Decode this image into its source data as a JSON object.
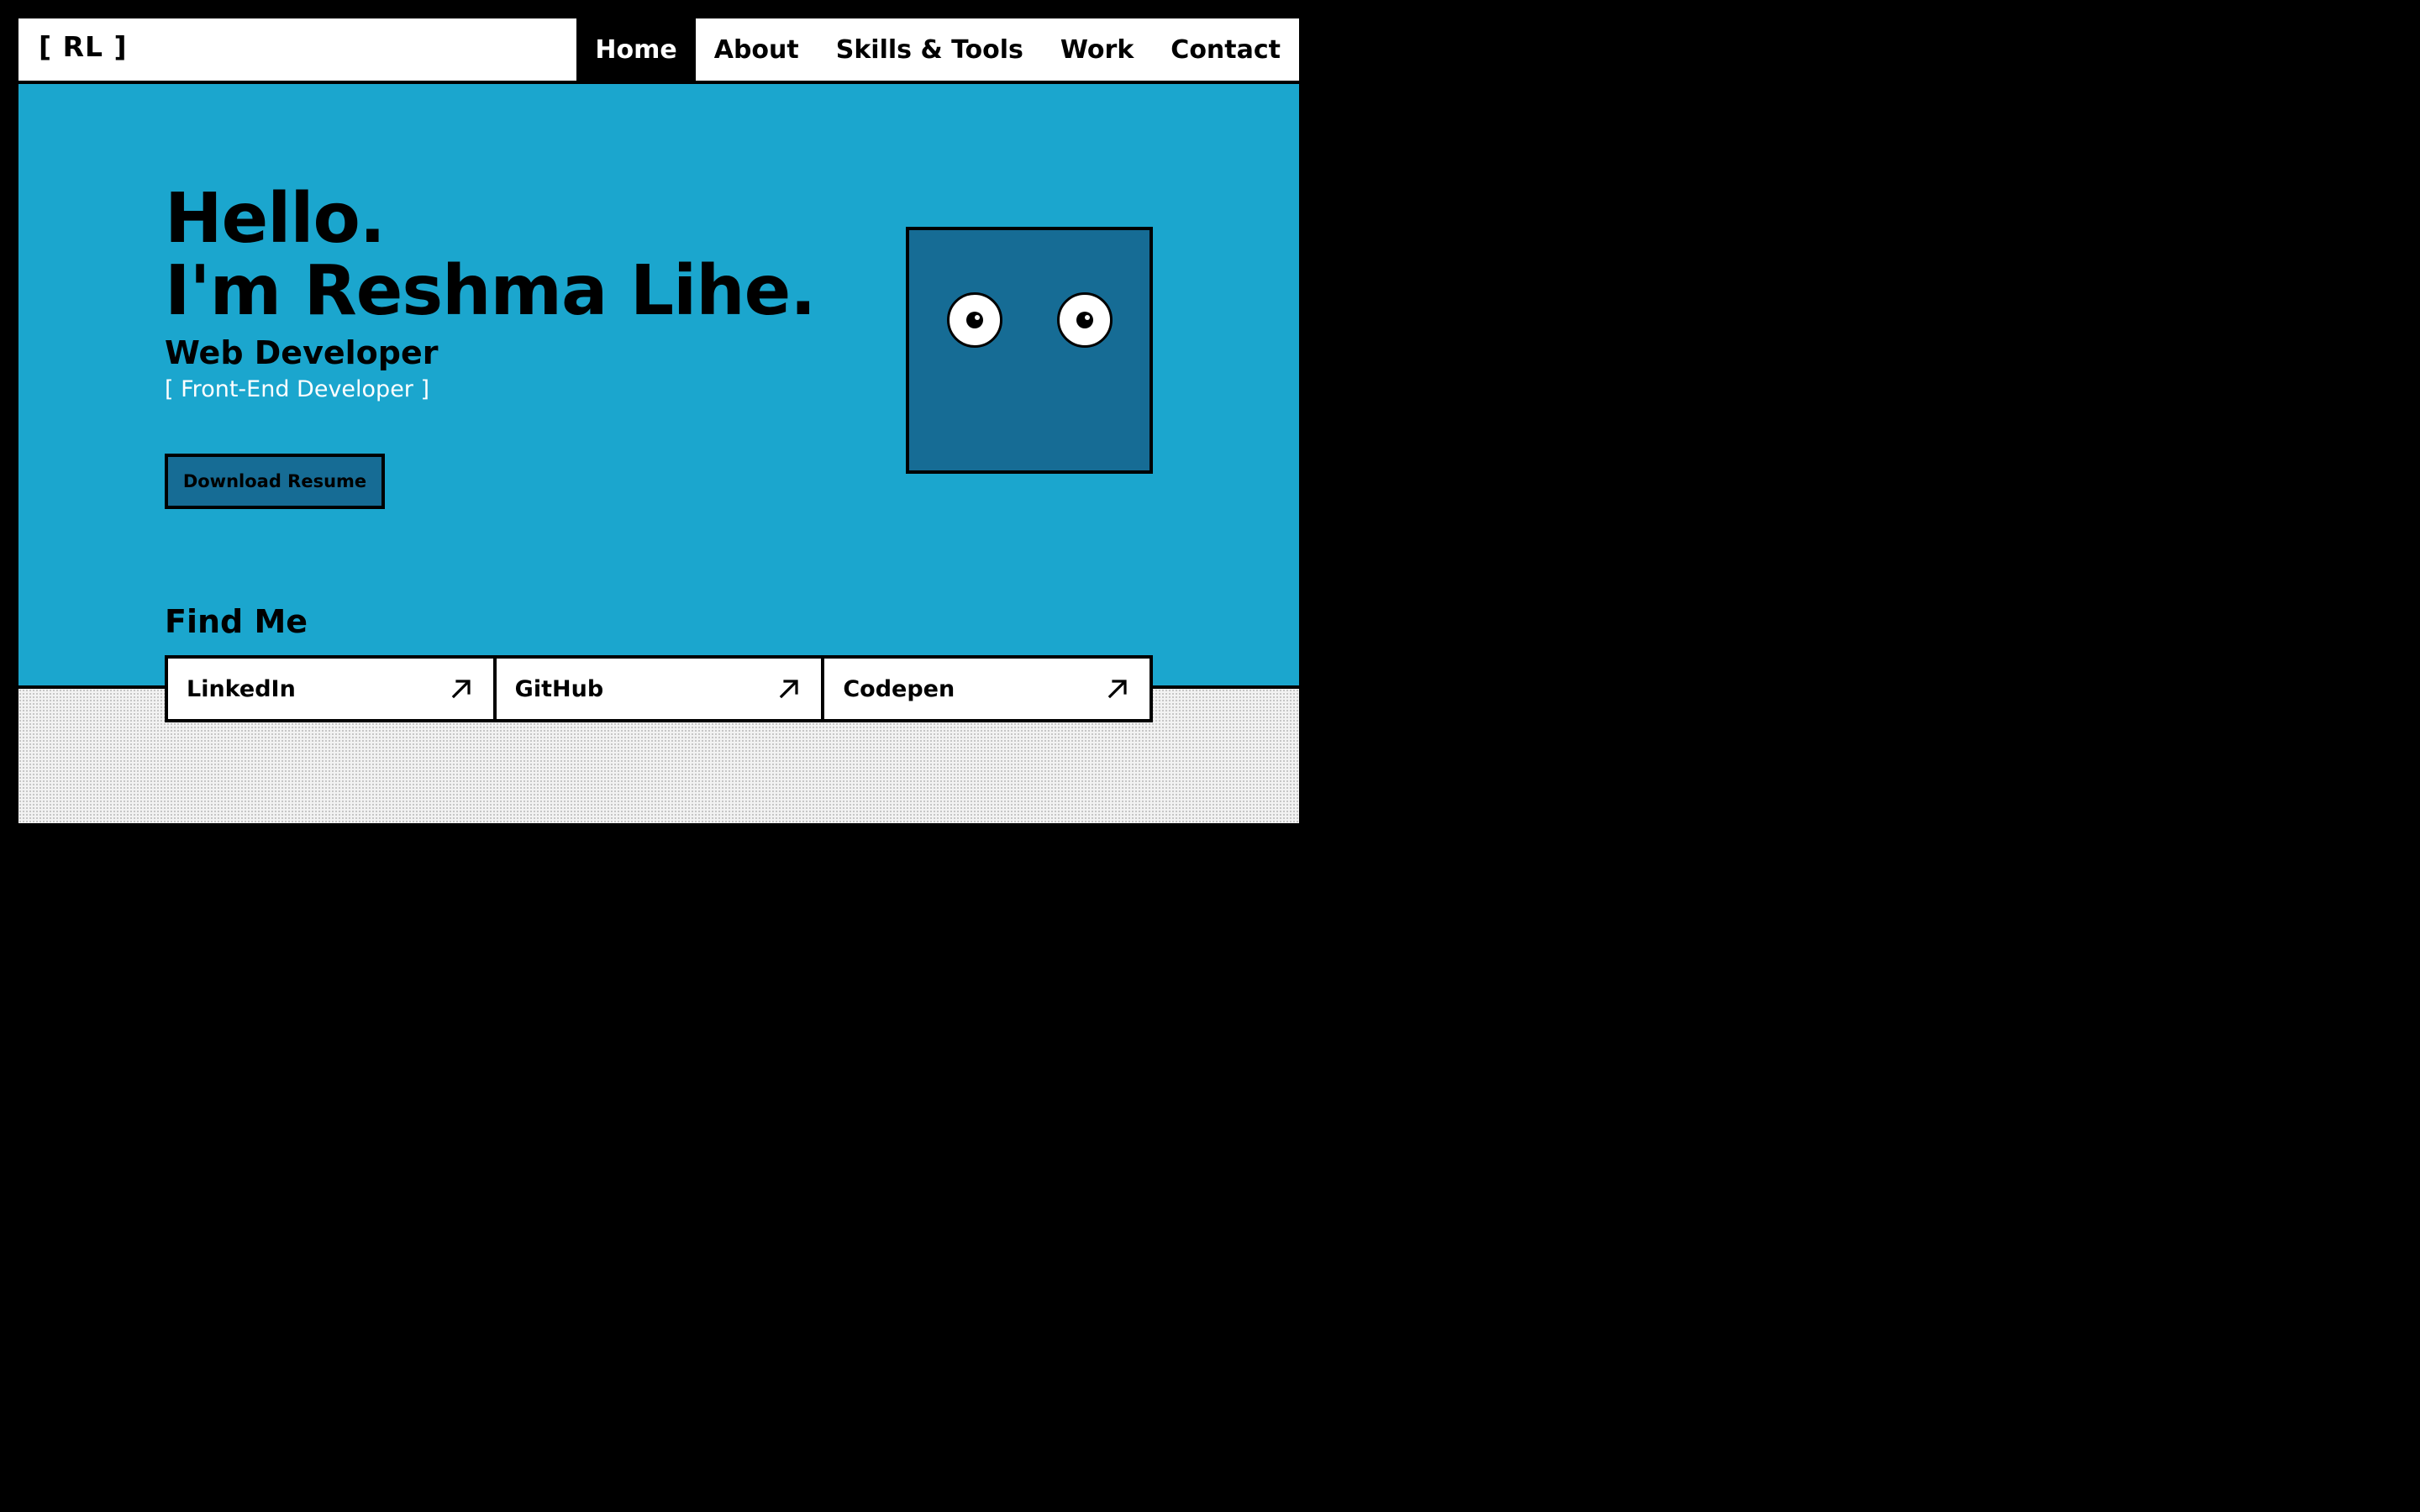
{
  "nav": {
    "logo": "[ RL ]",
    "links": [
      {
        "label": "Home",
        "active": true
      },
      {
        "label": "About"
      },
      {
        "label": "Skills & Tools"
      },
      {
        "label": "Work"
      },
      {
        "label": "Contact"
      }
    ]
  },
  "hero": {
    "greeting_line1": "Hello.",
    "greeting_line2": "I'm Reshma Lihe.",
    "role": "Web Developer",
    "subrole": "[ Front-End Developer ]",
    "resume_button": "Download Resume"
  },
  "findme": {
    "title": "Find Me",
    "links": [
      {
        "label": "LinkedIn",
        "icon": "arrow-up-right-icon"
      },
      {
        "label": "GitHub",
        "icon": "arrow-up-right-icon"
      },
      {
        "label": "Codepen",
        "icon": "arrow-up-right-icon"
      }
    ]
  },
  "colors": {
    "hero_bg": "#1ba6ce",
    "accent_dark": "#166c95",
    "border": "#000000",
    "nav_active_bg": "#000000",
    "subrole_text": "#ffffff"
  }
}
